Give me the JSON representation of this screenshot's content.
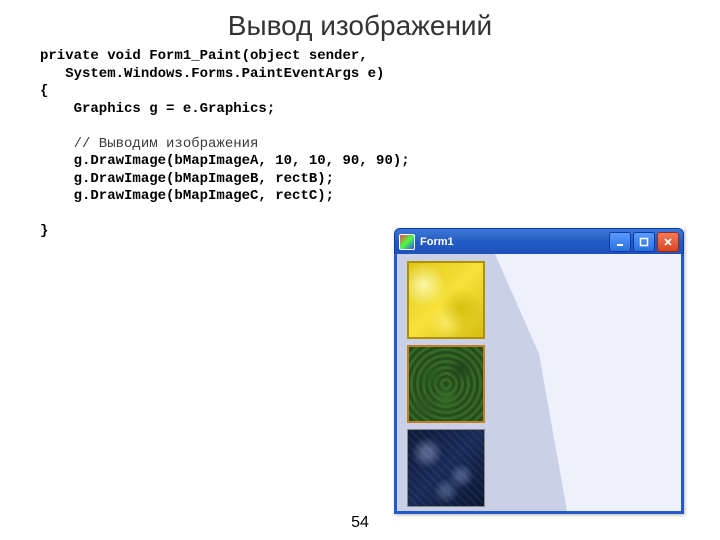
{
  "slide": {
    "title": "Вывод изображений",
    "page_number": "54"
  },
  "code": {
    "line1": "private void Form1_Paint(object sender,",
    "line2": "   System.Windows.Forms.PaintEventArgs e)",
    "line3": "{",
    "line4": "    Graphics g = e.Graphics;",
    "blank1": " ",
    "commentA": "    // Выводим изображения",
    "line5": "    g.DrawImage(bMapImageA, 10, 10, 90, 90);",
    "line6": "    g.DrawImage(bMapImageB, rectB);",
    "line7": "    g.DrawImage(bMapImageC, rectC);",
    "blank2": " ",
    "line8": "}"
  },
  "window": {
    "title": "Form1",
    "icons": {
      "app": "app-icon",
      "minimize": "minimize-icon",
      "maximize": "maximize-icon",
      "close": "close-icon"
    },
    "thumbnails": {
      "a": "yellow-texture",
      "b": "green-texture",
      "c": "blue-texture"
    }
  }
}
